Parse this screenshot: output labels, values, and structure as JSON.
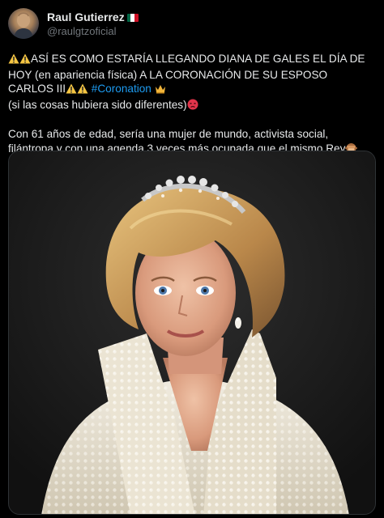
{
  "author": {
    "display_name": "Raul Gutierrez",
    "handle": "@raulgtzoficial",
    "flag_icon": "mexico-flag-icon"
  },
  "tweet": {
    "line1": "ASÍ ES COMO ESTARÍA LLEGANDO DIANA DE GALES EL DÍA DE HOY (en apariencia física) A LA CORONACIÓN DE SU ESPOSO CARLOS III",
    "hashtag": "#Coronation",
    "line2": "(si las cosas hubiera sido diferentes)",
    "line3": "Con 61 años de edad, sería una mujer de mundo, activista social, filántropa y con una agenda 3 veces más ocupada que el mismo Rey",
    "emojis": [
      "warning-icon",
      "warning-icon",
      "warning-icon",
      "warning-icon",
      "crown-icon",
      "angry-face-icon",
      "see-no-evil-monkey-icon"
    ]
  },
  "colors": {
    "background": "#000000",
    "text": "#e7e9ea",
    "secondary_text": "#71767b",
    "link": "#1d9bf0"
  }
}
